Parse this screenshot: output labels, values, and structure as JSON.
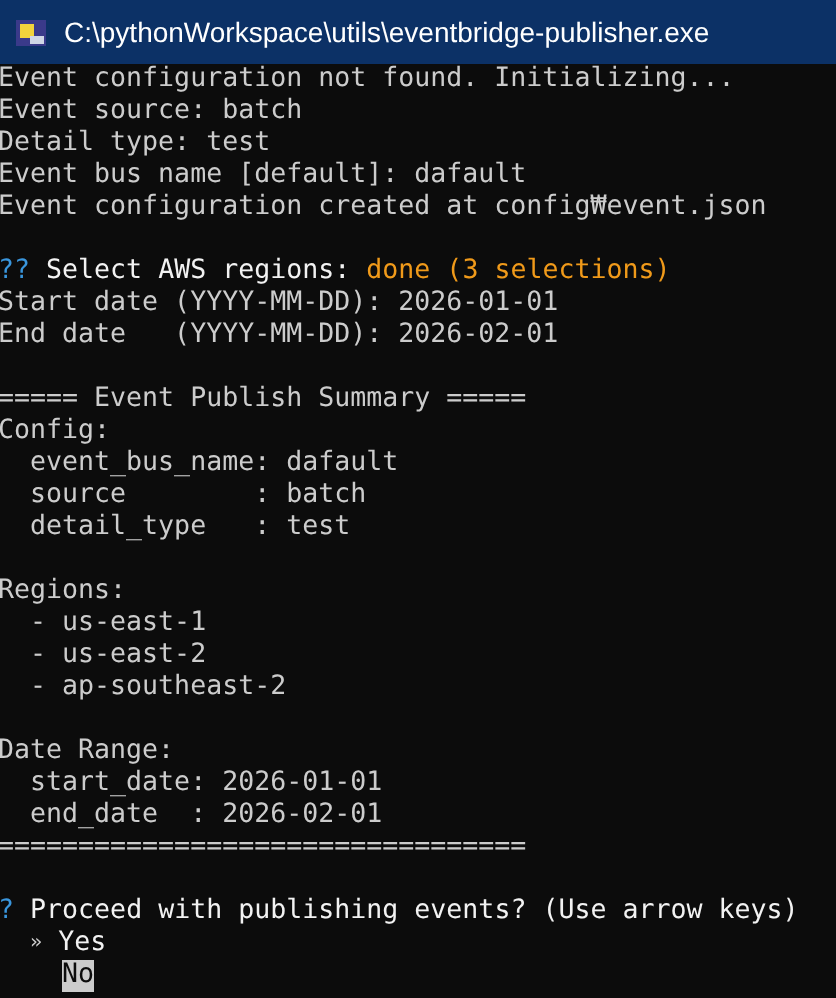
{
  "window": {
    "title": "C:\\pythonWorkspace\\utils\\eventbridge-publisher.exe"
  },
  "lines": [
    {
      "kind": "text",
      "text": "Event configuration not found. Initializing..."
    },
    {
      "kind": "text",
      "text": "Event source: batch"
    },
    {
      "kind": "text",
      "text": "Detail type: test"
    },
    {
      "kind": "text",
      "text": "Event bus name [default]: dafault"
    },
    {
      "kind": "text",
      "text": "Event configuration created at config₩event.json"
    },
    {
      "kind": "blank"
    },
    {
      "kind": "question",
      "mark": "??",
      "text": "Select AWS regions:",
      "answer": "done (3 selections)"
    },
    {
      "kind": "text",
      "text": "Start date (YYYY-MM-DD): 2026-01-01"
    },
    {
      "kind": "text",
      "text": "End date   (YYYY-MM-DD): 2026-02-01"
    },
    {
      "kind": "blank"
    },
    {
      "kind": "text",
      "text": "===== Event Publish Summary ====="
    },
    {
      "kind": "text",
      "text": "Config:"
    },
    {
      "kind": "text",
      "text": "  event_bus_name: dafault"
    },
    {
      "kind": "text",
      "text": "  source        : batch"
    },
    {
      "kind": "text",
      "text": "  detail_type   : test"
    },
    {
      "kind": "blank"
    },
    {
      "kind": "text",
      "text": "Regions:"
    },
    {
      "kind": "text",
      "text": "  - us-east-1"
    },
    {
      "kind": "text",
      "text": "  - us-east-2"
    },
    {
      "kind": "text",
      "text": "  - ap-southeast-2"
    },
    {
      "kind": "blank"
    },
    {
      "kind": "text",
      "text": "Date Range:"
    },
    {
      "kind": "text",
      "text": "  start_date: 2026-01-01"
    },
    {
      "kind": "text",
      "text": "  end_date  : 2026-02-01"
    },
    {
      "kind": "text",
      "text": "================================="
    },
    {
      "kind": "blank"
    },
    {
      "kind": "question",
      "mark": "?",
      "text": "Proceed with publishing events? (Use arrow keys)"
    }
  ],
  "prompt": {
    "pointer": "»",
    "options": [
      {
        "label": "Yes",
        "selected": true,
        "cursor": false
      },
      {
        "label": "No",
        "selected": false,
        "cursor": true
      }
    ]
  }
}
